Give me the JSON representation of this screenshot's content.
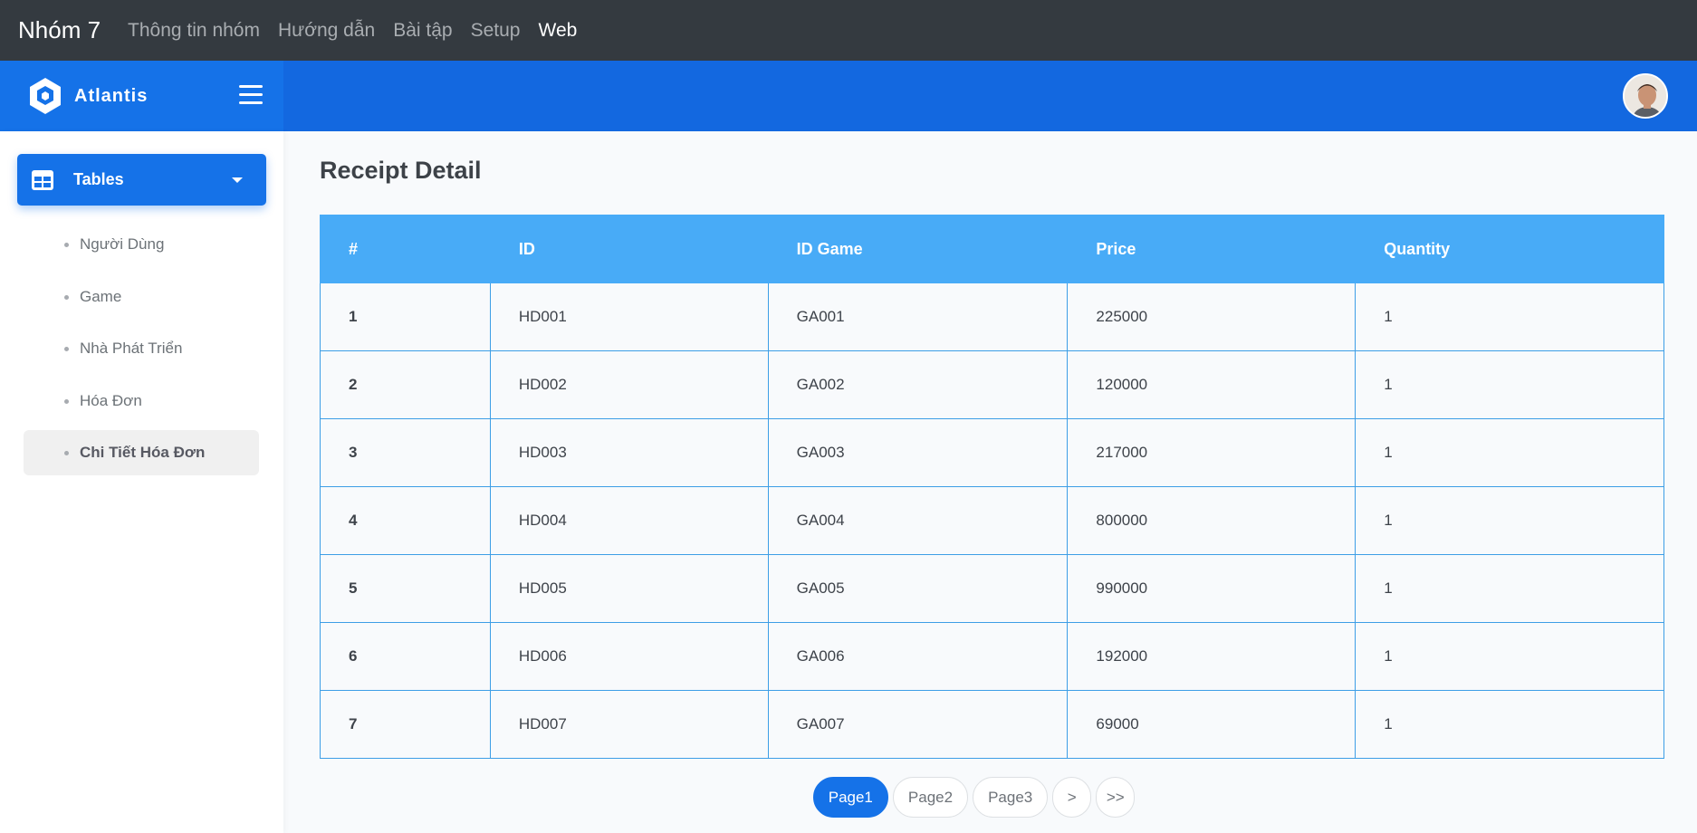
{
  "topbar": {
    "brand": "Nhóm 7",
    "links": [
      {
        "label": "Thông tin nhóm"
      },
      {
        "label": "Hướng dẫn"
      },
      {
        "label": "Bài tập"
      },
      {
        "label": "Setup"
      },
      {
        "label": "Web",
        "active": true
      }
    ]
  },
  "header": {
    "logo_text": "Atlantis",
    "accent_color": "#1572e8"
  },
  "sidebar": {
    "section_label": "Tables",
    "items": [
      {
        "label": "Người Dùng"
      },
      {
        "label": "Game"
      },
      {
        "label": "Nhà Phát Triển"
      },
      {
        "label": "Hóa Đơn"
      },
      {
        "label": "Chi Tiết Hóa Đơn",
        "active": true
      }
    ]
  },
  "main": {
    "title": "Receipt Detail",
    "table": {
      "headers": [
        "#",
        "ID",
        "ID Game",
        "Price",
        "Quantity"
      ],
      "rows": [
        [
          "1",
          "HD001",
          "GA001",
          "225000",
          "1"
        ],
        [
          "2",
          "HD002",
          "GA002",
          "120000",
          "1"
        ],
        [
          "3",
          "HD003",
          "GA003",
          "217000",
          "1"
        ],
        [
          "4",
          "HD004",
          "GA004",
          "800000",
          "1"
        ],
        [
          "5",
          "HD005",
          "GA005",
          "990000",
          "1"
        ],
        [
          "6",
          "HD006",
          "GA006",
          "192000",
          "1"
        ],
        [
          "7",
          "HD007",
          "GA007",
          "69000",
          "1"
        ]
      ]
    },
    "pagination": {
      "pages": [
        "Page1",
        "Page2",
        "Page3"
      ],
      "current": "Page1",
      "next_label": ">",
      "last_label": ">>"
    }
  }
}
